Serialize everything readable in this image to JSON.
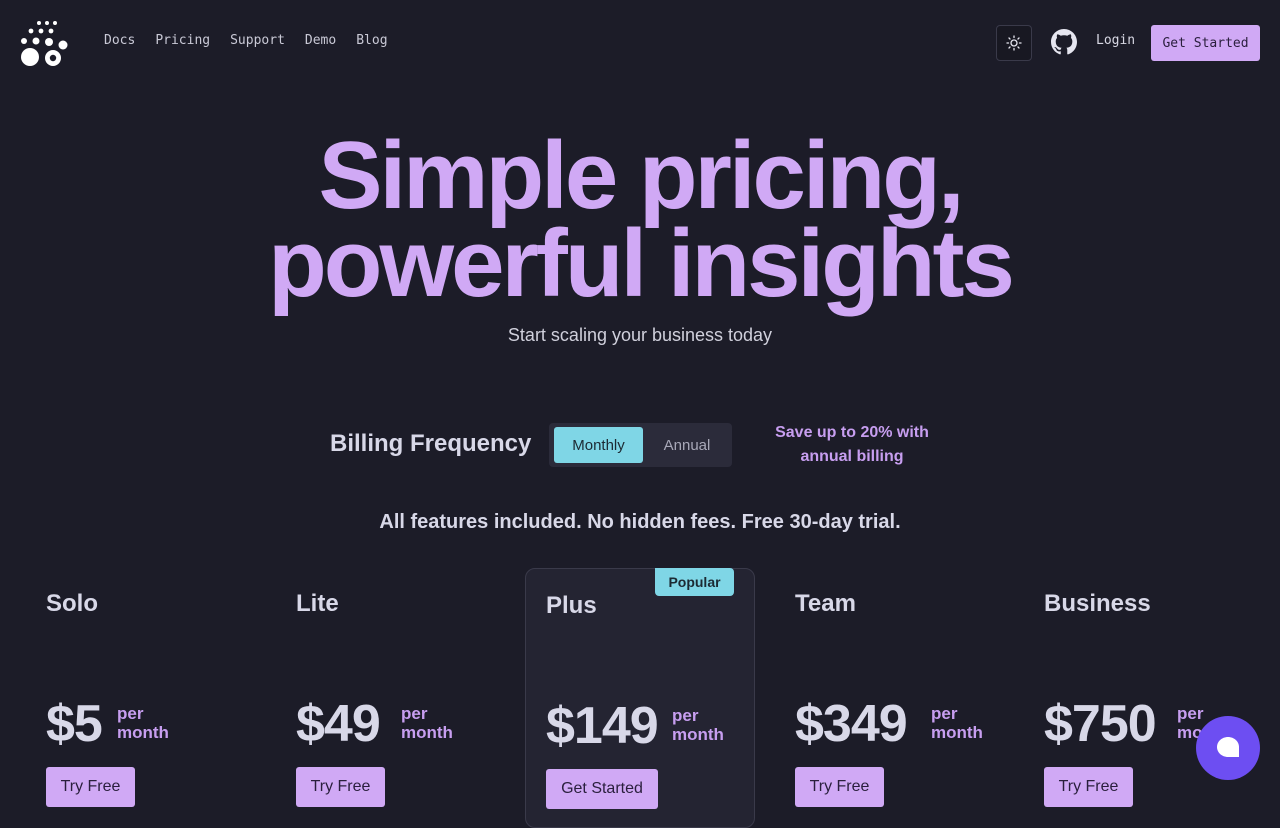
{
  "nav": {
    "links": [
      "Docs",
      "Pricing",
      "Support",
      "Demo",
      "Blog"
    ],
    "login": "Login",
    "get_started": "Get Started"
  },
  "hero": {
    "title_line1": "Simple pricing,",
    "title_line2": "powerful insights",
    "subtitle": "Start scaling your business today"
  },
  "billing": {
    "label": "Billing Frequency",
    "options": [
      "Monthly",
      "Annual"
    ],
    "selected": "Monthly",
    "save_line1": "Save up to 20% with",
    "save_line2": "annual billing"
  },
  "features_line": "All features included. No hidden fees. Free 30-day trial.",
  "plans": [
    {
      "name": "Solo",
      "price": "$5",
      "per1": "per",
      "per2": "month",
      "cta": "Try Free"
    },
    {
      "name": "Lite",
      "price": "$49",
      "per1": "per",
      "per2": "month",
      "cta": "Try Free"
    },
    {
      "name": "Plus",
      "price": "$149",
      "per1": "per",
      "per2": "month",
      "cta": "Get Started",
      "badge": "Popular"
    },
    {
      "name": "Team",
      "price": "$349",
      "per1": "per",
      "per2": "month",
      "cta": "Try Free"
    },
    {
      "name": "Business",
      "price": "$750",
      "per1": "per",
      "per2": "month",
      "cta": "Try Free"
    }
  ],
  "colors": {
    "background": "#1c1c28",
    "accent": "#d0a9f5",
    "cyan": "#7fd6e6",
    "chat": "#6d4ef2"
  },
  "icons": [
    "logo-dots",
    "sun-icon",
    "github-icon",
    "chat-icon"
  ]
}
